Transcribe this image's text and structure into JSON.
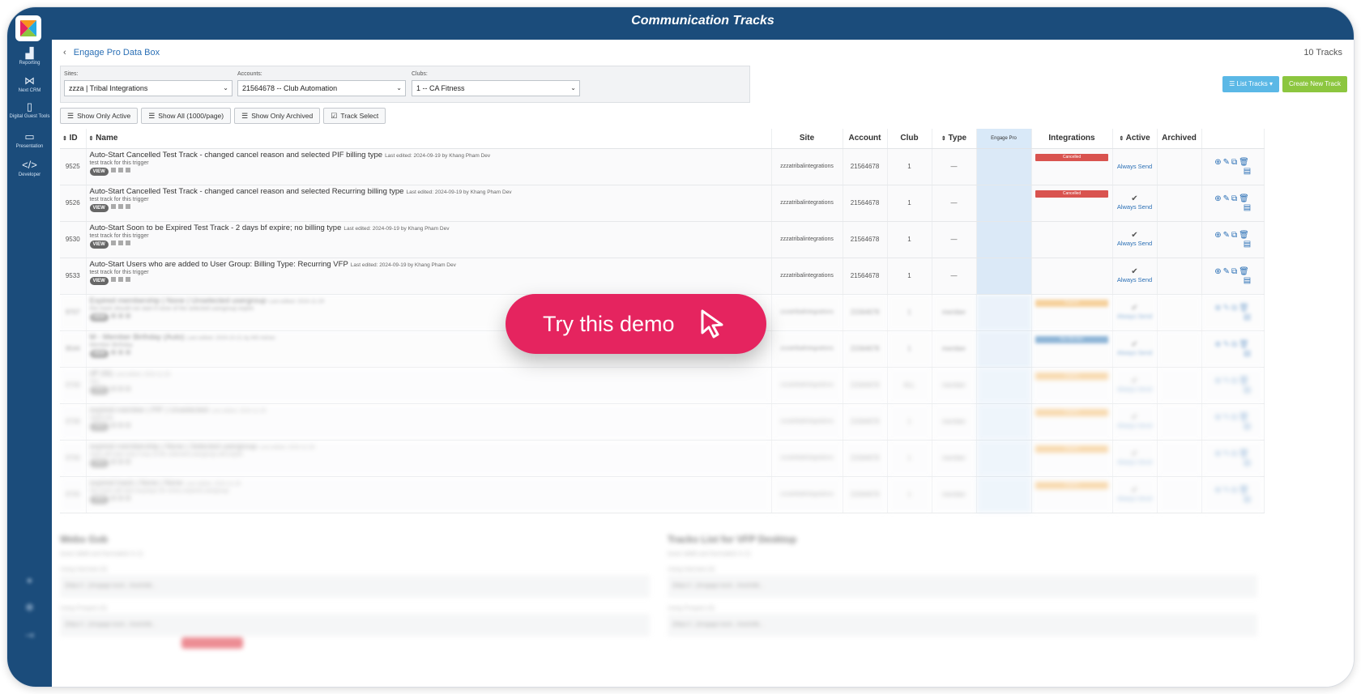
{
  "window": {
    "title": "Communication Tracks"
  },
  "sidebar": {
    "items": [
      {
        "label": "Reporting",
        "icon": "chart-icon"
      },
      {
        "label": "Next CRM",
        "icon": "crm-icon"
      },
      {
        "label": "Digital Guest Tools",
        "icon": "tablet-icon"
      },
      {
        "label": "Presentation",
        "icon": "monitor-icon"
      },
      {
        "label": "Developer",
        "icon": "code-icon"
      }
    ]
  },
  "breadcrumb": {
    "back_label": "Engage Pro Data Box"
  },
  "track_count": "10 Tracks",
  "filters": {
    "sites_label": "Sites:",
    "sites_value": "zzza | Tribal Integrations",
    "accounts_label": "Accounts:",
    "accounts_value": "21564678 -- Club Automation",
    "clubs_label": "Clubs:",
    "clubs_value": "1 -- CA Fitness"
  },
  "actions": {
    "list_tracks": "List Tracks",
    "create_track": "Create New Track"
  },
  "toolbar": {
    "show_active": "Show Only Active",
    "show_all": "Show All (1000/page)",
    "show_archived": "Show Only Archived",
    "track_select": "Track Select"
  },
  "table": {
    "headers": {
      "id": "ID",
      "name": "Name",
      "site": "Site",
      "account": "Account",
      "club": "Club",
      "type": "Type",
      "engage_pro": "Engage Pro",
      "integrations": "Integrations",
      "active": "Active",
      "archived": "Archived"
    },
    "view_label": "VIEW",
    "rows": [
      {
        "id": "9525",
        "name": "Auto-Start Cancelled Test Track - changed cancel reason and selected PIF billing type",
        "edited": "Last edited: 2024-09-19 by Khang Pham Dev",
        "desc": "test track for this trigger",
        "site": "zzzatribalintegrations",
        "account": "21564678",
        "club": "1",
        "type": "—",
        "integration": "Cancelled",
        "active": "Always Send"
      },
      {
        "id": "9526",
        "name": "Auto-Start Cancelled Test Track - changed cancel reason and selected Recurring billing type",
        "edited": "Last edited: 2024-09-19 by Khang Pham Dev",
        "desc": "test track for this trigger",
        "site": "zzzatribalintegrations",
        "account": "21564678",
        "club": "1",
        "type": "—",
        "integration": "Cancelled",
        "active": "Always Send"
      },
      {
        "id": "9530",
        "name": "Auto-Start Soon to be Expired Test Track - 2 days bf expire; no billing type",
        "edited": "Last edited: 2024-09-19 by Khang Pham Dev",
        "desc": "test track for this trigger",
        "site": "zzzatribalintegrations",
        "account": "21564678",
        "club": "1",
        "type": "—",
        "integration": "",
        "active": "Always Send"
      },
      {
        "id": "9533",
        "name": "Auto-Start Users who are added to User Group: Billing Type: Recurring VFP",
        "edited": "Last edited: 2024-09-19 by Khang Pham Dev",
        "desc": "test track for this trigger",
        "site": "zzzatribalintegrations",
        "account": "21564678",
        "club": "1",
        "type": "—",
        "integration": "",
        "active": "Always Send"
      },
      {
        "id": "9707",
        "name": "Expired membership | None | Unselected usergroup",
        "edited": "Last edited: 2024-11-29",
        "desc": "this track should not start if none of the selected usergroup expire",
        "site": "zzzatribalintegrations",
        "account": "21564678",
        "club": "1",
        "type": "member",
        "integration": "Expired",
        "active": "Always Send"
      },
      {
        "id": "9544",
        "name": "M - Member Birthday (Auto)",
        "edited": "Last edited: 2024-10-21 by MS Adrian",
        "desc": "Member Birthday",
        "site": "zzzatribalintegrations",
        "account": "21564678",
        "club": "1",
        "type": "member",
        "integration": "Non-Member",
        "active": "Always Send"
      },
      {
        "id": "9709",
        "name": "dP (fd)",
        "edited": "Last edited: 2024-11-29",
        "desc": "test",
        "site": "zzzatribalintegrations",
        "account": "21564678",
        "club": "ALL",
        "type": "member",
        "integration": "Expired",
        "active": "Always Send"
      },
      {
        "id": "9708",
        "name": "expired member | PIF | Unselected",
        "edited": "Last edited: 2024-11-29",
        "desc": "nbpfncab",
        "site": "zzzatribalintegrations",
        "account": "21564678",
        "club": "1",
        "type": "member",
        "integration": "Expired",
        "active": "Always Send"
      },
      {
        "id": "9706",
        "name": "expired membership | None | Selected usergroup",
        "edited": "Last edited: 2024-11-29",
        "desc": "track will start only if any of the selected usergroup will expire",
        "site": "zzzatribalintegrations",
        "account": "21564678",
        "club": "1",
        "type": "member",
        "integration": "Expired",
        "active": "Always Send"
      },
      {
        "id": "9705",
        "name": "expired track | None | None",
        "edited": "Last edited: 2024-11-29",
        "desc": "this track will start anyways for every expired usergroup",
        "site": "zzzatribalintegrations",
        "account": "21564678",
        "club": "1",
        "type": "member",
        "integration": "Expired",
        "active": "Always Send"
      }
    ]
  },
  "bottom": {
    "left_title": "Webs Gob",
    "right_title": "Tracks List for VFP Desktop",
    "left_sub": "(track Id&Bt and Normal&Sr in Z)",
    "right_sub": "(track Id&Bt and Normal&Sr in Z)",
    "label_1": "Using Interview (0)",
    "label_2": "Using Prospect (0)",
    "url_1": "{https://...}/engage.track.../trackId&...",
    "url_2": "{https://...}/engage.track.../trackId&..."
  },
  "cta": {
    "label": "Try this demo"
  },
  "colors": {
    "brand_blue": "#1b4c7b",
    "cta_pink": "#e5245f",
    "cancelled_red": "#d9534f",
    "expired_orange": "#f0ad4e",
    "nonmember_blue": "#337ab7",
    "list_blue": "#5bb8e6",
    "create_green": "#8cc63f"
  }
}
